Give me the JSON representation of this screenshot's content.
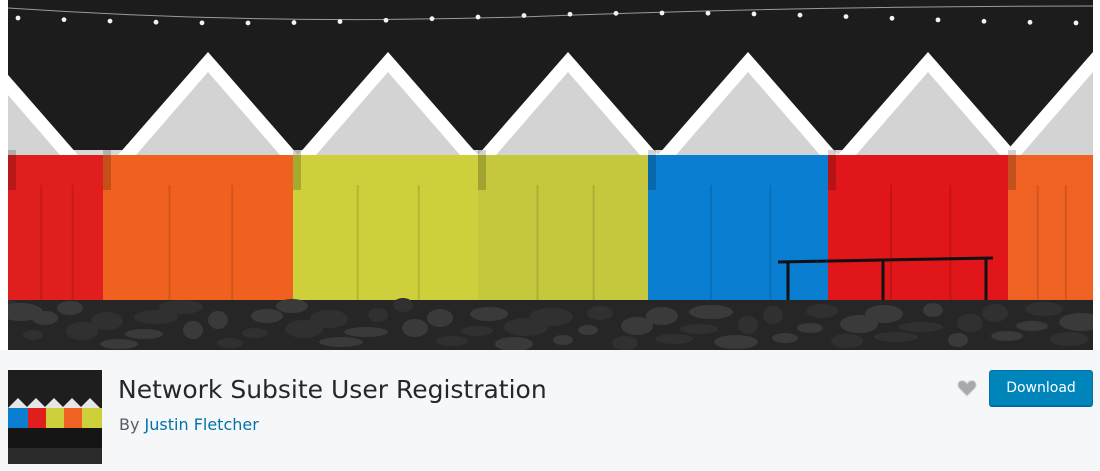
{
  "plugin": {
    "title": "Network Subsite User Registration",
    "by_prefix": "By",
    "author": "Justin Fletcher"
  },
  "actions": {
    "download_label": "Download",
    "favorite_icon": "heart-icon"
  },
  "banner": {
    "image": "beach-huts-photo",
    "hut_colors": [
      "#e01e1e",
      "#f0611f",
      "#cdd03a",
      "#c5c83c",
      "#0a7fd2",
      "#e0161b",
      "#f06224"
    ]
  },
  "colors": {
    "link": "#0073aa",
    "button_bg": "#0085ba",
    "header_bg": "#f6f7f9",
    "title": "#23282d"
  }
}
